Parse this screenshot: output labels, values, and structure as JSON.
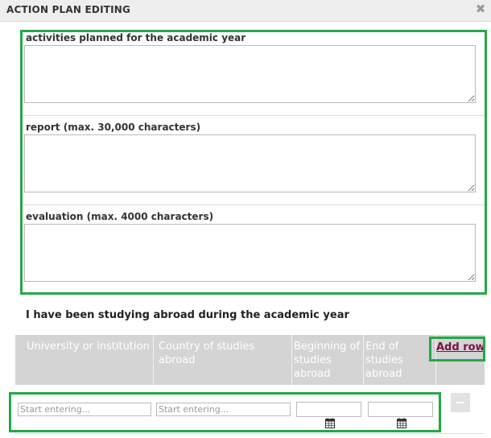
{
  "dialog": {
    "title": "ACTION PLAN EDITING",
    "close_glyph": "✖"
  },
  "fields": [
    {
      "label": "activities planned for the academic year",
      "value": ""
    },
    {
      "label": "report (max. 30,000 characters)",
      "value": ""
    },
    {
      "label": "evaluation (max. 4000 characters)",
      "value": ""
    }
  ],
  "abroad": {
    "heading": "I have been studying abroad during the academic year",
    "columns": [
      "University or institution",
      "Country of studies abroad",
      "Beginning of studies abroad",
      "End of studies abroad"
    ],
    "add_row_label": "Add row",
    "row": {
      "university_placeholder": "Start entering...",
      "country_placeholder": "Start entering...",
      "begin_value": "",
      "end_value": ""
    }
  },
  "icons": {
    "close": "close-icon",
    "calendar": "calendar-icon",
    "remove": "minus-icon"
  },
  "colors": {
    "highlight": "#22aa44",
    "header_bg": "#d4d4d4",
    "link": "#7a1040"
  }
}
